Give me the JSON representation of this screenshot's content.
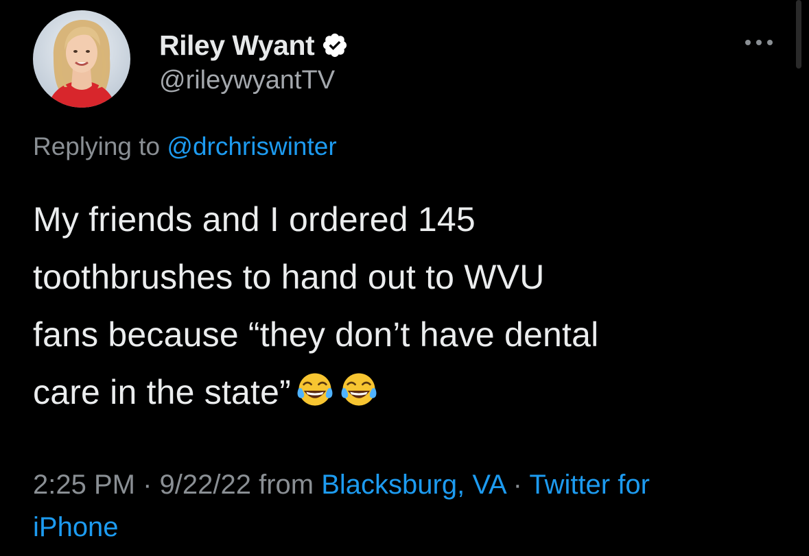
{
  "user": {
    "display_name": "Riley Wyant",
    "handle": "@rileywyantTV",
    "verified": true,
    "avatar_icon": "profile-photo"
  },
  "reply": {
    "prefix": "Replying to ",
    "to_handle": "@drchriswinter"
  },
  "tweet": {
    "lines": [
      "My friends and I ordered 145",
      "toothbrushes to hand out to WVU",
      "fans because “they don’t have dental",
      "care in the state”"
    ],
    "emojis": [
      "face-with-tears-of-joy-icon",
      "face-with-tears-of-joy-icon"
    ]
  },
  "meta": {
    "time": "2:25 PM",
    "sep1": " · ",
    "date": "9/22/22",
    "from_label": " from ",
    "location": "Blacksburg, VA",
    "sep2": " · ",
    "source_part1": "Twitter for",
    "source_part2": "iPhone"
  },
  "colors": {
    "background": "#000000",
    "text": "#e7e9ea",
    "secondary": "#8a8f94",
    "accent": "#1d9bf0"
  }
}
